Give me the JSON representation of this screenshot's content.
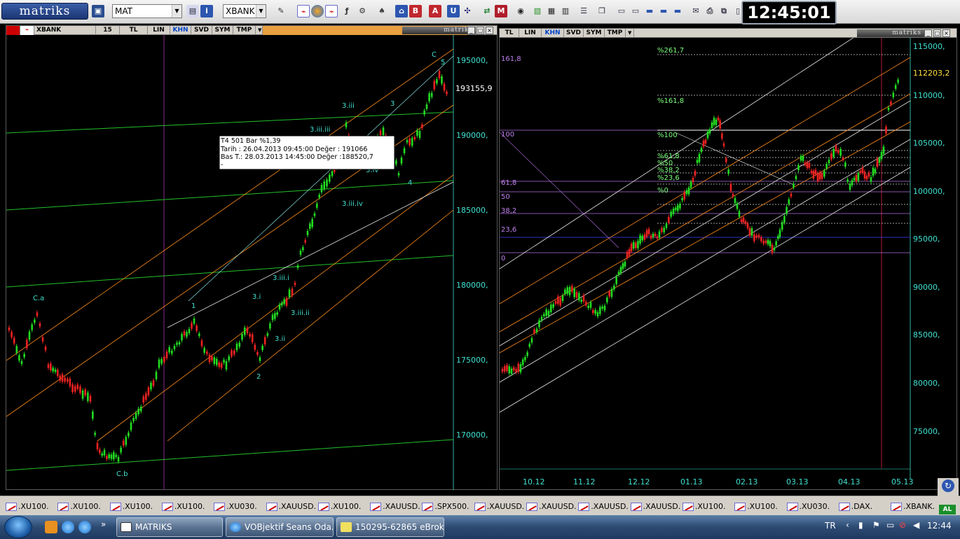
{
  "toolbar": {
    "logo": "matriks",
    "template_select": "MAT",
    "symbol_select": "XBANK",
    "clock": "12:45:01"
  },
  "left_panel": {
    "tabs": [
      "XBANK",
      "15",
      "TL",
      "LIN",
      "KHN",
      "SVD",
      "SYM",
      "TMP"
    ],
    "brand": "matriks",
    "price_axis": [
      "195000,",
      "190000,",
      "185000,",
      "180000,",
      "175000,",
      "170000,"
    ],
    "last_price": "193155,9",
    "wave_labels": [
      "C.a",
      "C.b",
      "1",
      "2",
      "3.i",
      "3.ii",
      "3.iii.i",
      "3.iii.ii",
      "3.iii.iii",
      "3.iii",
      "3.iii.iv",
      "3.iv",
      "3",
      "4",
      "5",
      "C"
    ],
    "tooltip": {
      "line1": "T4   501 Bar   %1,39",
      "line2": "Tarih : 26.04.2013 09:45:00 Değer : 191066",
      "line3": "Bas T.: 28.03.2013 14:45:00  Değer :188520,7",
      "line4": "-"
    }
  },
  "right_panel": {
    "tabs": [
      "TL",
      "LIN",
      "KHN",
      "SVD",
      "SYM",
      "TMP"
    ],
    "brand": "matriks",
    "price_axis": [
      "115000,",
      "110000,",
      "105000,",
      "100000,",
      "95000,",
      "90000,",
      "85000,",
      "80000,",
      "75000,"
    ],
    "last_price": "112203,2",
    "fib_inner": [
      "%261,7",
      "%161,8",
      "%100",
      "%61,8",
      "%50",
      "%38,2",
      "%23,6",
      "%0"
    ],
    "fib_left": [
      "161,8",
      "100",
      "61,8",
      "50",
      "38,2",
      "23,6",
      "0"
    ],
    "date_axis": [
      "10.12",
      "11.12",
      "12.12",
      "01.13",
      "02.13",
      "03.13",
      "04.13",
      "05.13"
    ]
  },
  "symbol_tabs": [
    ".XU100.",
    ".XU100.",
    ".XU100.",
    ".XU100.",
    ".XU030.",
    ".XAUUSD.",
    ".XU100.",
    ".XAUUSD.",
    ".SPX500.",
    ".XAUUSD.",
    ".XAUUSD.",
    ".XAUUSD.",
    ".XAUUSD.",
    ".XU100.",
    ".XU100.",
    ".XU030.",
    ".DAX.",
    ".XBANK."
  ],
  "corner_badge": "AL",
  "taskbar": {
    "tasks": [
      "MATRIKS",
      "VOBjektif Seans Oda...",
      "150295-62865 eBrok..."
    ],
    "lang": "TR",
    "time": "12:44"
  },
  "colors": {
    "up_candle": "#22dd22",
    "down_candle": "#ee2222",
    "teal_label": "#40e0d0",
    "fib_text": "#7cff7c",
    "orange_line": "#ff8c1a"
  }
}
